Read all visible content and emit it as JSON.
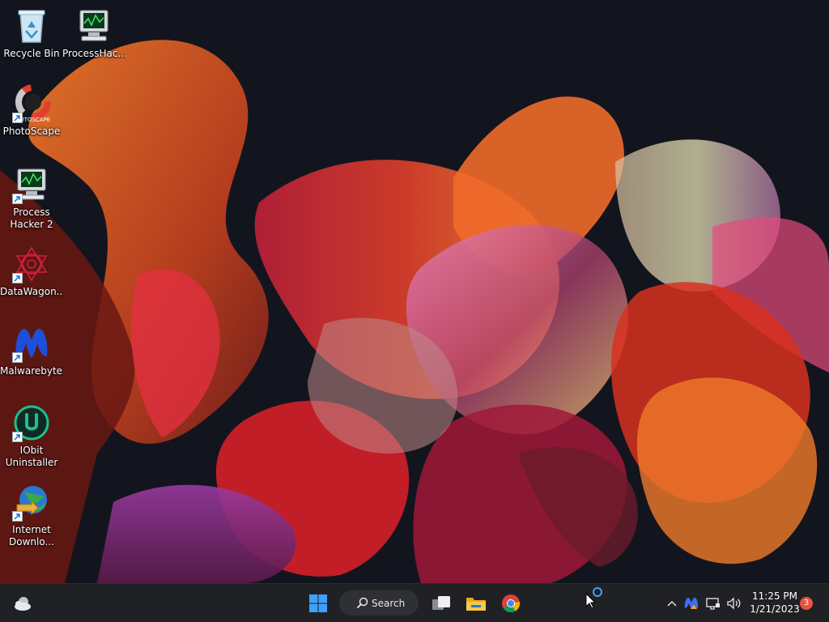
{
  "desktop": {
    "icons": [
      {
        "label": "Recycle Bin",
        "icon": "recycle-bin-icon"
      },
      {
        "label": "ProcessHac...",
        "icon": "process-hacker-icon"
      },
      {
        "label": "PhotoScape",
        "icon": "photoscape-icon",
        "logo_text": "AUTOSCAPE"
      },
      {
        "label": "Process Hacker 2",
        "icon": "process-hacker-icon"
      },
      {
        "label": "DataWagon...",
        "icon": "datawagon-icon"
      },
      {
        "label": "Malwarebytes",
        "icon": "malwarebytes-icon"
      },
      {
        "label": "IObit Uninstaller",
        "icon": "iobit-uninstaller-icon"
      },
      {
        "label": "Internet Downlo...",
        "icon": "internet-download-manager-icon"
      }
    ]
  },
  "taskbar": {
    "search_label": "Search",
    "pinned": [
      "start-icon",
      "task-view-icon",
      "file-explorer-icon",
      "chrome-icon"
    ],
    "tray": {
      "time": "11:25 PM",
      "date": "1/21/2023",
      "notification_count": "3"
    }
  },
  "colors": {
    "taskbar_bg": "#202124",
    "start_blue": "#3ea0ff",
    "badge": "#e8533f"
  }
}
